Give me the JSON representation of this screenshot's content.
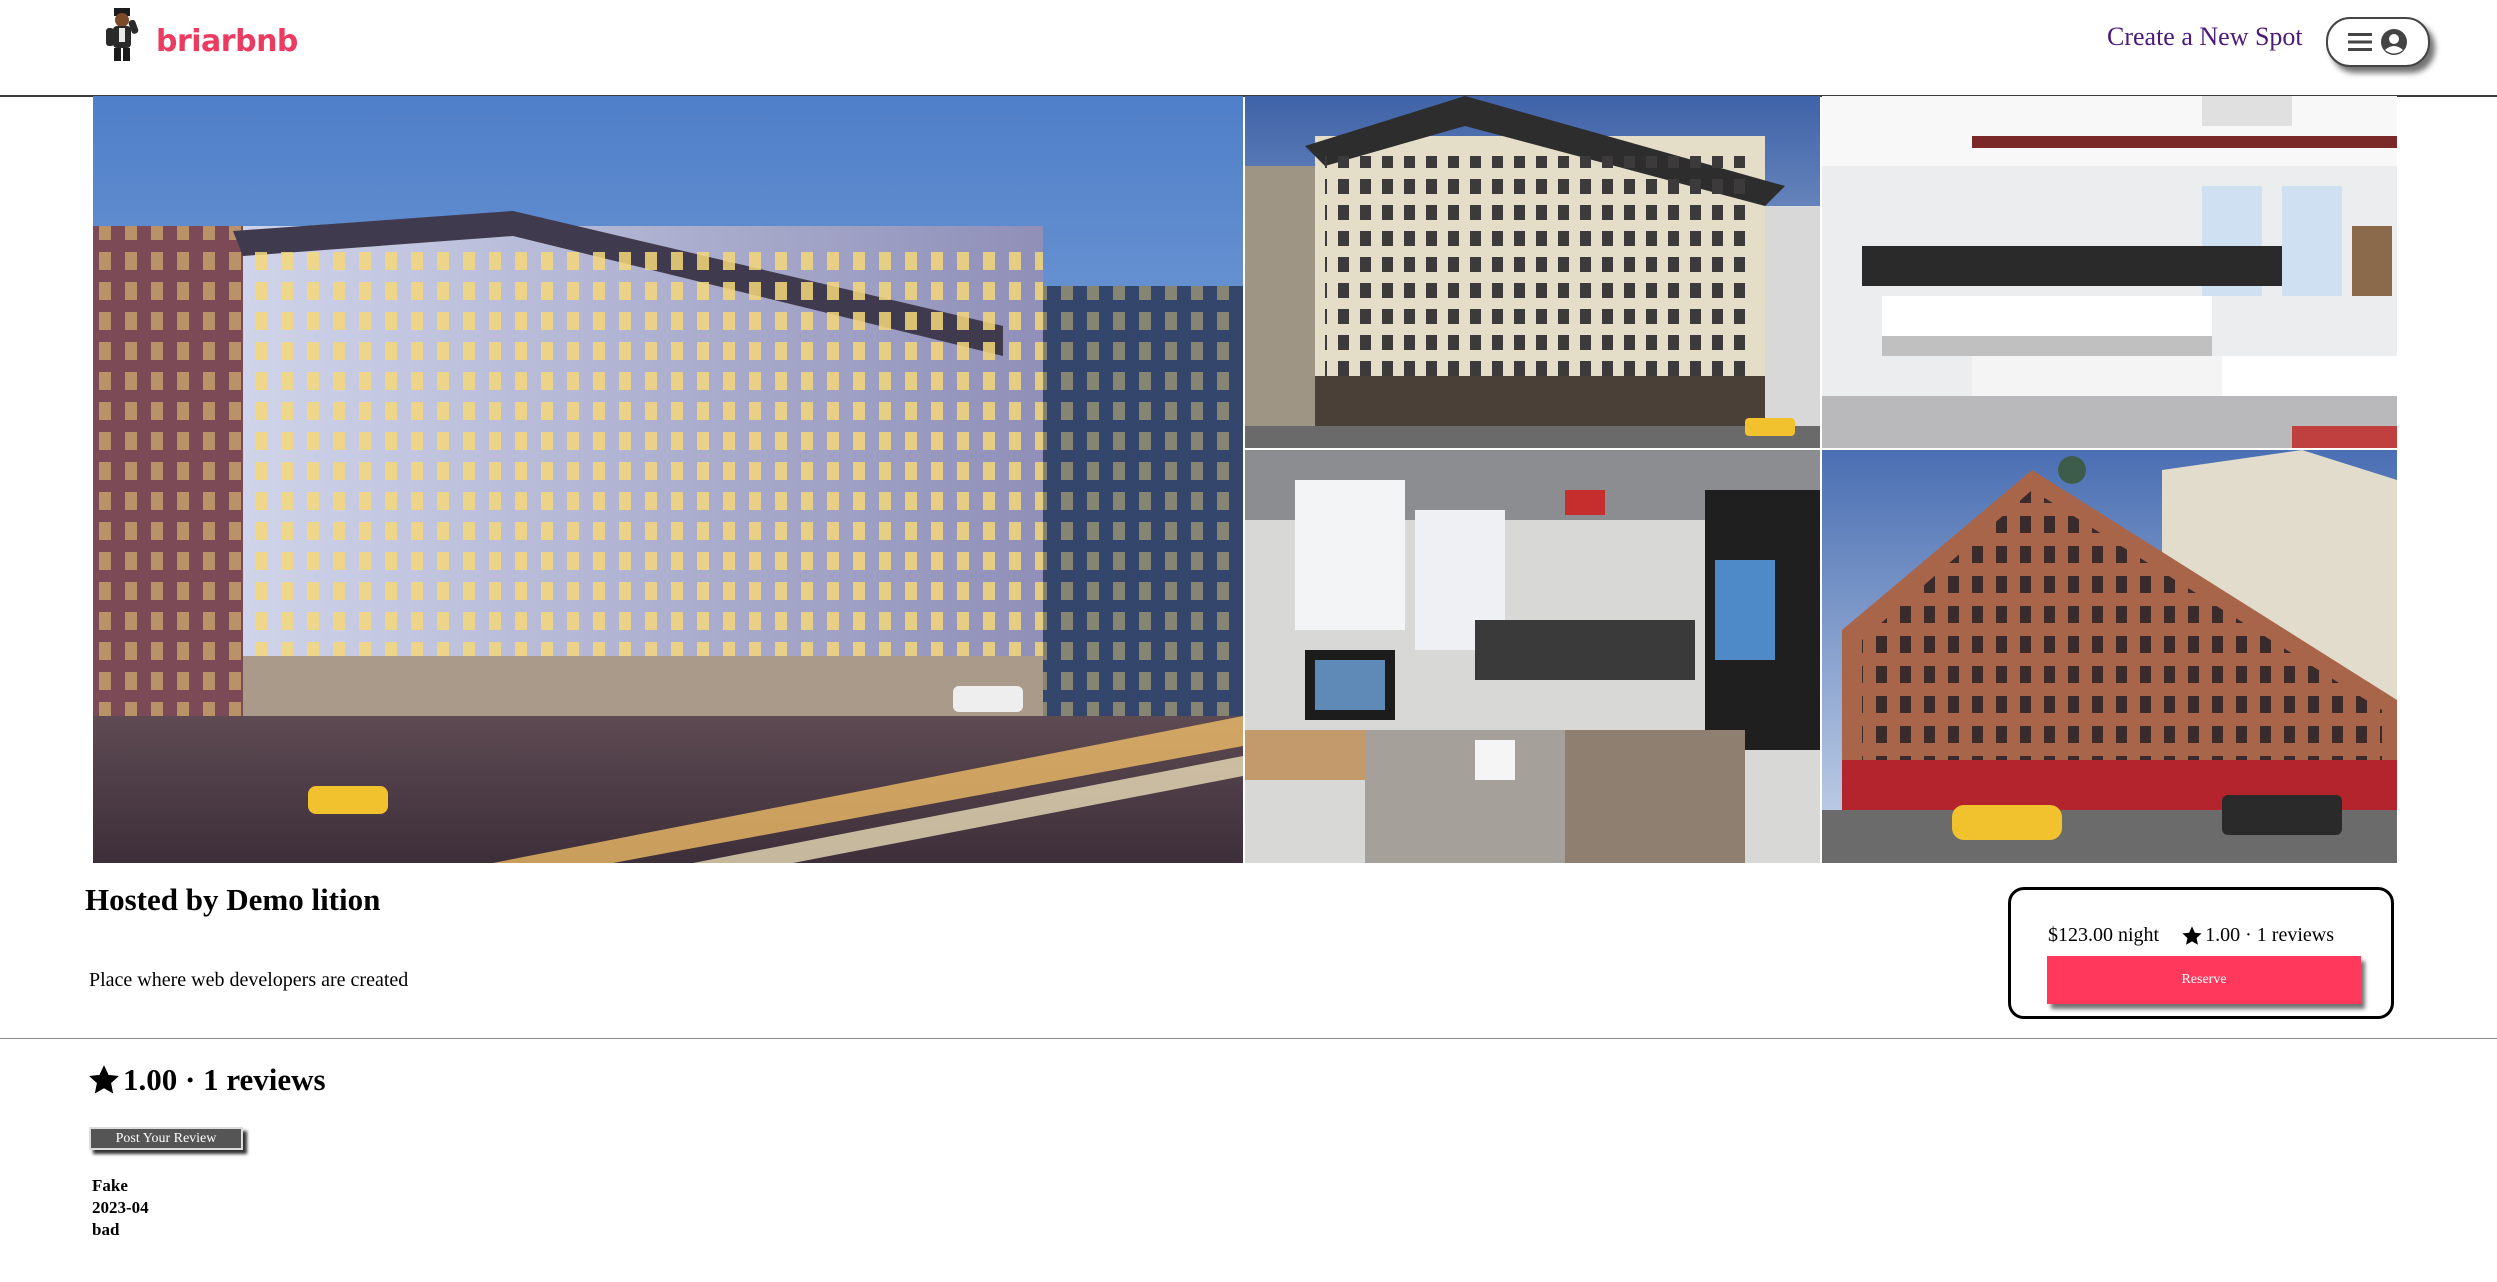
{
  "header": {
    "logo_text": "briarbnb",
    "create_spot_label": "Create a New Spot",
    "profile_button_icons": [
      "menu-icon",
      "user-icon"
    ]
  },
  "gallery": {
    "images": [
      "Large corner office building at dusk with busy intersection",
      "Beige office building exterior in daylight",
      "Open-plan office interior with desks and monitors",
      "Office interior with desk and computers",
      "Red-brick corner building with yellow taxi"
    ]
  },
  "spot": {
    "host_title": "Hosted by Demo lition",
    "description": "Place where web developers are created"
  },
  "reserve": {
    "price_text": "$123.00 night",
    "rating_text": "1.00 · 1 reviews",
    "button_label": "Reserve"
  },
  "reviews": {
    "summary_text": "1.00 · 1 reviews",
    "post_button_label": "Post Your Review",
    "items": [
      {
        "author": "Fake",
        "date": "2023-04",
        "text": "bad"
      }
    ]
  },
  "colors": {
    "brand": "#ec3b61",
    "reserve_button": "#ff385c",
    "create_link": "#4b1a7a"
  }
}
